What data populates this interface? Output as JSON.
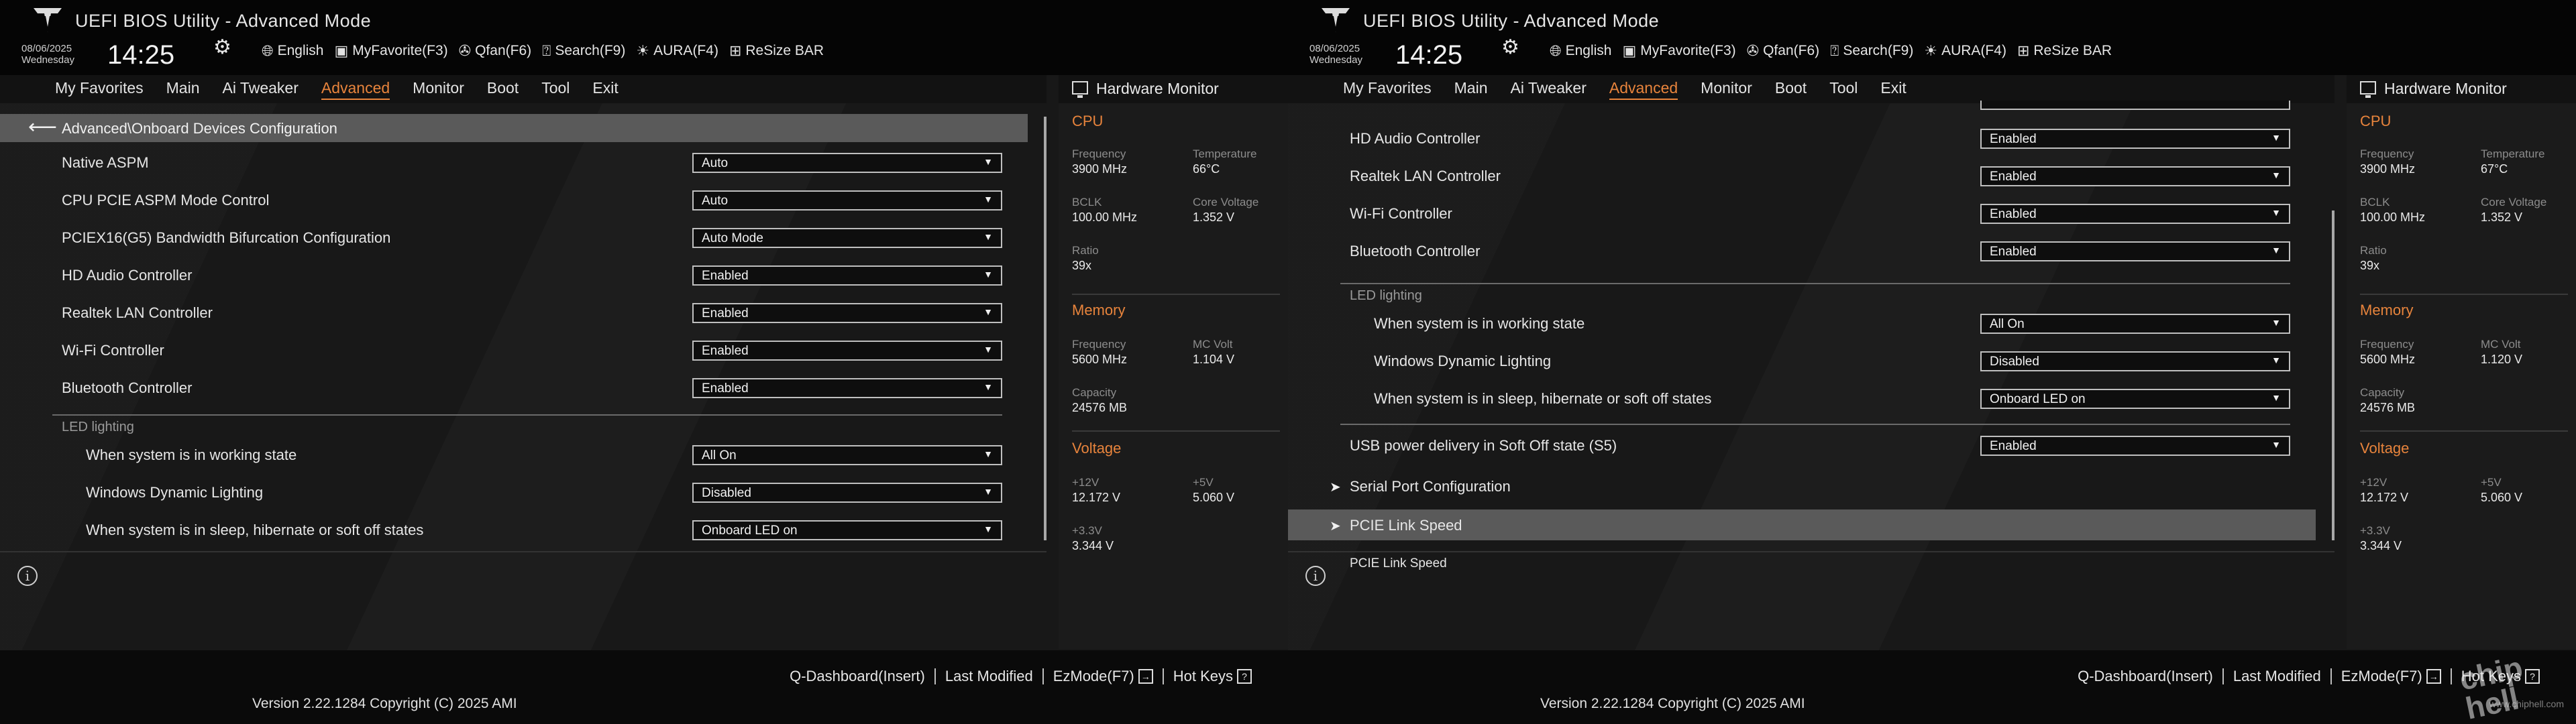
{
  "common": {
    "app_title": "UEFI BIOS Utility - Advanced Mode",
    "date": "08/06/2025",
    "day": "Wednesday",
    "time": "14:25",
    "toolbar": [
      "English",
      "MyFavorite(F3)",
      "Qfan(F6)",
      "Search(F9)",
      "AURA(F4)",
      "ReSize BAR"
    ],
    "menu": [
      "My Favorites",
      "Main",
      "Ai Tweaker",
      "Advanced",
      "Monitor",
      "Boot",
      "Tool",
      "Exit"
    ],
    "active_menu": "Advanced",
    "hw_title": "Hardware Monitor",
    "hotkeys": [
      "Q-Dashboard(Insert)",
      "Last Modified",
      "EzMode(F7)",
      "Hot Keys"
    ],
    "version": "Version 2.22.1284 Copyright (C) 2025 AMI",
    "accent_color": "#e8843c"
  },
  "left": {
    "breadcrumb": "Advanced\\Onboard Devices Configuration",
    "rows": [
      {
        "label": "Native ASPM",
        "value": "Auto"
      },
      {
        "label": "CPU PCIE ASPM Mode Control",
        "value": "Auto"
      },
      {
        "label": "PCIEX16(G5) Bandwidth Bifurcation Configuration",
        "value": "Auto Mode"
      },
      {
        "label": "HD Audio Controller",
        "value": "Enabled"
      },
      {
        "label": "Realtek LAN Controller",
        "value": "Enabled"
      },
      {
        "label": "Wi-Fi Controller",
        "value": "Enabled"
      },
      {
        "label": "Bluetooth Controller",
        "value": "Enabled"
      }
    ],
    "section": "LED lighting",
    "led_rows": [
      {
        "label": "When system is in working state",
        "value": "All On"
      },
      {
        "label": "Windows Dynamic Lighting",
        "value": "Disabled"
      },
      {
        "label": "When system is in sleep, hibernate or soft off states",
        "value": "Onboard LED on"
      }
    ],
    "info_text": "",
    "hw": {
      "cpu": "CPU",
      "cpu_freq_label": "Frequency",
      "cpu_freq": "3900 MHz",
      "cpu_temp_label": "Temperature",
      "cpu_temp": "66°C",
      "bclk_label": "BCLK",
      "bclk": "100.00 MHz",
      "vcore_label": "Core Voltage",
      "vcore": "1.352 V",
      "ratio_label": "Ratio",
      "ratio": "39x",
      "memory": "Memory",
      "mem_freq_label": "Frequency",
      "mem_freq": "5600 MHz",
      "mc_volt_label": "MC Volt",
      "mc_volt": "1.104 V",
      "capacity_label": "Capacity",
      "capacity": "24576 MB",
      "voltage": "Voltage",
      "v12_label": "+12V",
      "v12": "12.172 V",
      "v5_label": "+5V",
      "v5": "5.060 V",
      "v33_label": "+3.3V",
      "v33": "3.344 V"
    }
  },
  "right": {
    "rows": [
      {
        "label": "HD Audio Controller",
        "value": "Enabled"
      },
      {
        "label": "Realtek LAN Controller",
        "value": "Enabled"
      },
      {
        "label": "Wi-Fi Controller",
        "value": "Enabled"
      },
      {
        "label": "Bluetooth Controller",
        "value": "Enabled"
      }
    ],
    "section": "LED lighting",
    "led_rows": [
      {
        "label": "When system is in working state",
        "value": "All On"
      },
      {
        "label": "Windows Dynamic Lighting",
        "value": "Disabled"
      },
      {
        "label": "When system is in sleep, hibernate or soft off states",
        "value": "Onboard LED on"
      }
    ],
    "usb_row": {
      "label": "USB power delivery in Soft Off state (S5)",
      "value": "Enabled"
    },
    "subitems": [
      "Serial Port Configuration",
      "PCIE Link Speed"
    ],
    "selected_subitem": "PCIE Link Speed",
    "info_text": "PCIE Link Speed",
    "watermark": "chip hell",
    "watermark_url": "www.chiphell.com",
    "hw": {
      "cpu": "CPU",
      "cpu_freq_label": "Frequency",
      "cpu_freq": "3900 MHz",
      "cpu_temp_label": "Temperature",
      "cpu_temp": "67°C",
      "bclk_label": "BCLK",
      "bclk": "100.00 MHz",
      "vcore_label": "Core Voltage",
      "vcore": "1.352 V",
      "ratio_label": "Ratio",
      "ratio": "39x",
      "memory": "Memory",
      "mem_freq_label": "Frequency",
      "mem_freq": "5600 MHz",
      "mc_volt_label": "MC Volt",
      "mc_volt": "1.120 V",
      "capacity_label": "Capacity",
      "capacity": "24576 MB",
      "voltage": "Voltage",
      "v12_label": "+12V",
      "v12": "12.172 V",
      "v5_label": "+5V",
      "v5": "5.060 V",
      "v33_label": "+3.3V",
      "v33": "3.344 V"
    }
  }
}
